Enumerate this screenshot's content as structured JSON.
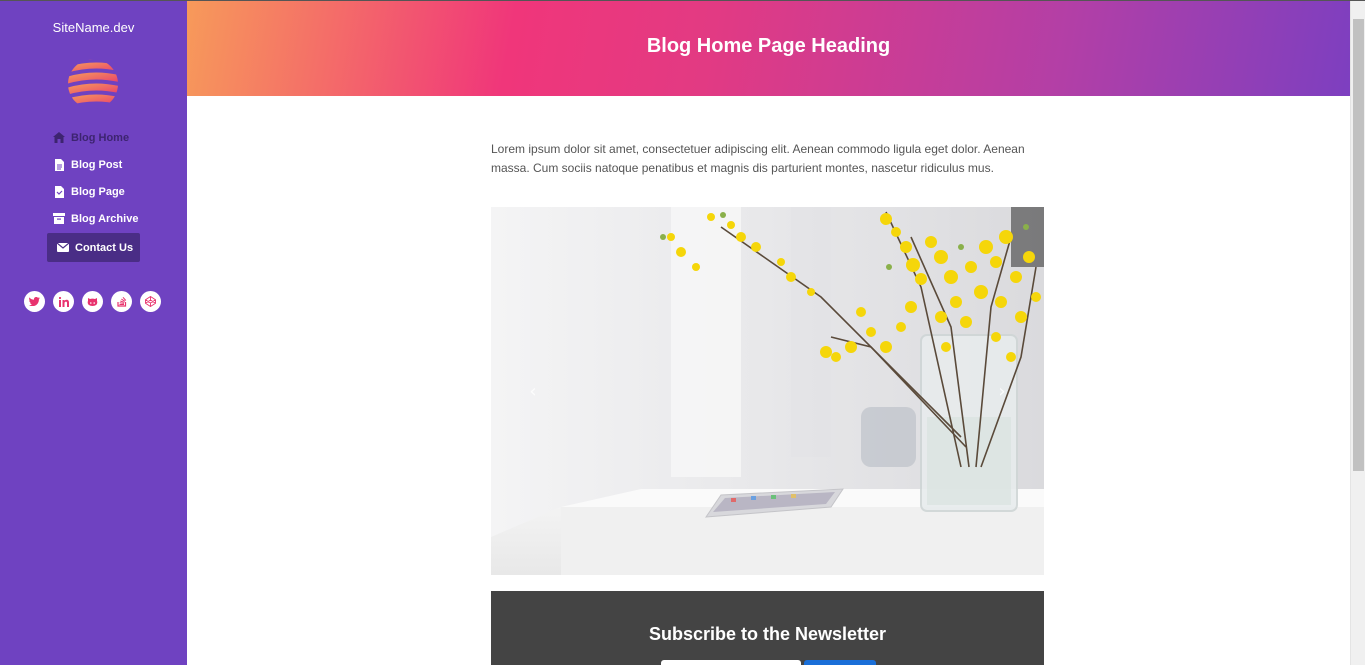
{
  "sidebar": {
    "site_name": "SiteName.dev",
    "logo_icon": "globe-logo",
    "nav": [
      {
        "label": "Blog Home",
        "icon": "home-icon"
      },
      {
        "label": "Blog Post",
        "icon": "file-icon"
      },
      {
        "label": "Blog Page",
        "icon": "file-icon"
      },
      {
        "label": "Blog Archive",
        "icon": "archive-icon"
      },
      {
        "label": "Contact Us",
        "icon": "envelope-icon",
        "active": true
      }
    ],
    "socials": [
      "twitter-icon",
      "linkedin-icon",
      "github-icon",
      "stackoverflow-icon",
      "codepen-icon"
    ]
  },
  "header": {
    "heading": "Blog Home Page Heading"
  },
  "main": {
    "lead": "Lorem ipsum dolor sit amet, consectetuer adipiscing elit. Aenean commodo ligula eget dolor. Aenean massa. Cum sociis natoque penatibus et magnis dis parturient montes, nascetur ridiculus mus.",
    "carousel": {
      "prev_icon": "chevron-left-icon",
      "next_icon": "chevron-right-icon"
    }
  },
  "newsletter": {
    "title": "Subscribe to the Newsletter"
  },
  "colors": {
    "sidebar": "#6f42c1",
    "accent": "#e8336e",
    "newsletter_bg": "#444444"
  }
}
